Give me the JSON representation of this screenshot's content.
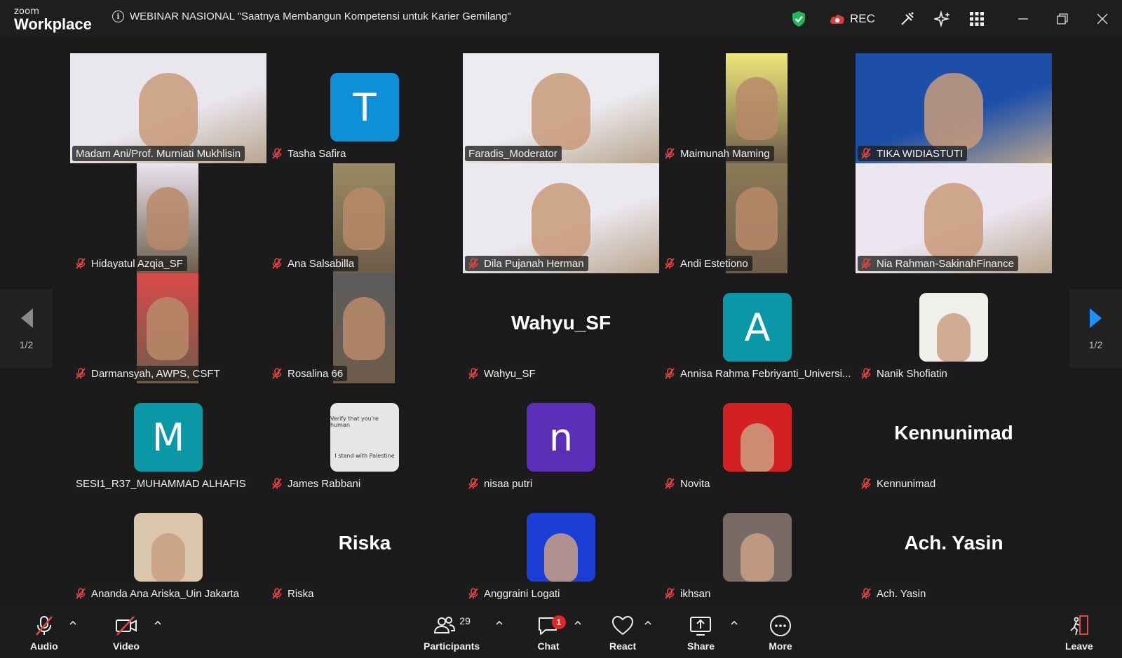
{
  "app": {
    "logo_small": "zoom",
    "logo_big": "Workplace"
  },
  "meeting": {
    "title": "WEBINAR NASIONAL \"Saatnya Membangun Kompetensi untuk Karier Gemilang\""
  },
  "titlebar": {
    "rec_label": "REC"
  },
  "pagination": {
    "left": "1/2",
    "right": "1/2"
  },
  "participants": [
    {
      "name": "Madam Ani/Prof. Murniati Mukhlisin",
      "type": "video",
      "muted": false,
      "bg": "#e9e6ee"
    },
    {
      "name": "Tasha Safira",
      "type": "avatar",
      "letter": "T",
      "color": "#0e8fd8",
      "muted": true
    },
    {
      "name": "Faradis_Moderator",
      "type": "video",
      "muted": false,
      "active": true,
      "bg": "#ecebf0"
    },
    {
      "name": "Maimunah Maming",
      "type": "video-narrow",
      "muted": true,
      "bg": "#efe77a"
    },
    {
      "name": "TIKA WIDIASTUTI",
      "type": "video",
      "muted": true,
      "bg": "#1d4fa8"
    },
    {
      "name": "Hidayatul Azqia_SF",
      "type": "video-narrow",
      "muted": true,
      "bg": "#e9e4ef"
    },
    {
      "name": "Ana Salsabilla",
      "type": "video-narrow",
      "muted": true,
      "bg": "#9a8b63"
    },
    {
      "name": "Dila Pujanah Herman",
      "type": "video",
      "muted": true,
      "bg": "#ebe8ef"
    },
    {
      "name": "Andi Estetiono",
      "type": "video-narrow",
      "muted": true,
      "bg": "#8a7a56"
    },
    {
      "name": "Nia Rahman-SakinahFinance",
      "type": "video",
      "muted": true,
      "bg": "#ebe6ef"
    },
    {
      "name": "Darmansyah, AWPS, CSFT",
      "type": "video-narrow",
      "muted": true,
      "bg": "#d94a4a"
    },
    {
      "name": "Rosalina 66",
      "type": "video-narrow",
      "muted": true,
      "bg": "#5c5c5c"
    },
    {
      "name": "Wahyu_SF",
      "type": "text",
      "muted": true
    },
    {
      "name": "Annisa Rahma Febriyanti_Universi...",
      "type": "avatar",
      "letter": "A",
      "color": "#0b98a6",
      "muted": true
    },
    {
      "name": "Nanik Shofiatin",
      "type": "photo",
      "muted": true,
      "bg": "#f1efec"
    },
    {
      "name": "SESI1_R37_MUHAMMAD ALHAFIS",
      "type": "avatar",
      "letter": "M",
      "color": "#0b98a6",
      "muted": false
    },
    {
      "name": "James Rabbani",
      "type": "photo-screen",
      "muted": true,
      "bg": "#e6e6e6",
      "screen_title": "Verify that you're human",
      "screen_text": "I stand with Palestine"
    },
    {
      "name": "nisaa putri",
      "type": "avatar",
      "letter": "n",
      "color": "#5b2fb8",
      "muted": true
    },
    {
      "name": "Novita",
      "type": "photo",
      "muted": true,
      "bg": "#d42020"
    },
    {
      "name": "Kennunimad",
      "type": "text",
      "muted": true
    },
    {
      "name": "Ananda Ana Ariska_Uin Jakarta",
      "type": "photo",
      "muted": true,
      "bg": "#d9c6ab"
    },
    {
      "name": "Riska",
      "type": "text",
      "muted": true
    },
    {
      "name": "Anggraini Logati",
      "type": "photo",
      "muted": true,
      "bg": "#1b3fd6"
    },
    {
      "name": "ikhsan",
      "type": "photo",
      "muted": true,
      "bg": "#7a6a66"
    },
    {
      "name": "Ach. Yasin",
      "type": "text",
      "muted": true
    }
  ],
  "toolbar": {
    "audio": "Audio",
    "video": "Video",
    "participants": "Participants",
    "participants_count": "29",
    "chat": "Chat",
    "chat_badge": "1",
    "react": "React",
    "share": "Share",
    "more": "More",
    "leave": "Leave"
  },
  "colors": {
    "active_border": "#22c55e",
    "shield": "#1fb85a",
    "rec_icon": "#e23a3a",
    "nav_arrow": "#1e90ff",
    "mute": "#e44545"
  }
}
